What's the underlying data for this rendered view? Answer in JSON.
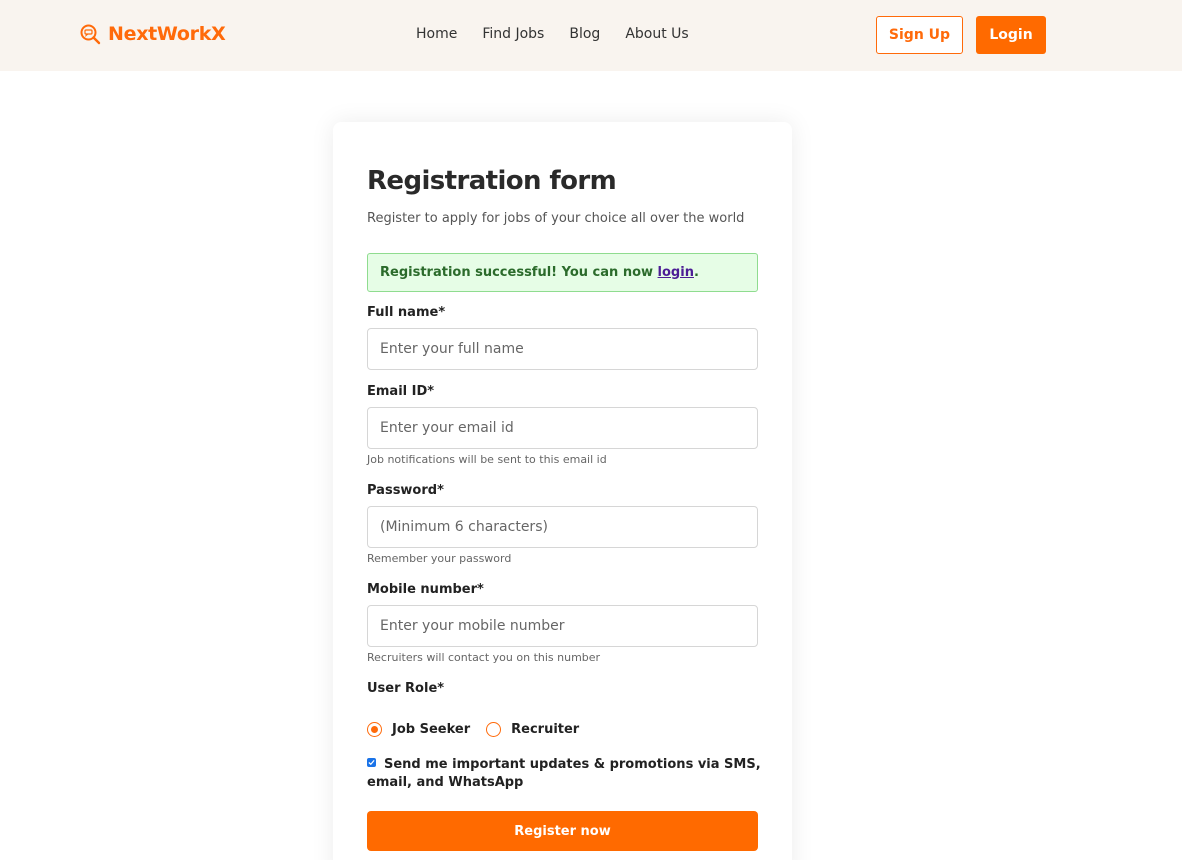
{
  "brand": {
    "name": "NextWorkX",
    "icon": "search-chat-icon",
    "color": "#ff6a0a"
  },
  "nav": {
    "links": [
      "Home",
      "Find Jobs",
      "Blog",
      "About Us"
    ],
    "signup_label": "Sign Up",
    "login_label": "Login"
  },
  "form": {
    "title": "Registration form",
    "subtitle": "Register to apply for jobs of your choice all over the world",
    "alert": {
      "text": "Registration successful! You can now ",
      "link": "login",
      "suffix": "."
    },
    "full_name": {
      "label": "Full name*",
      "placeholder": "Enter your full name"
    },
    "email": {
      "label": "Email ID*",
      "placeholder": "Enter your email id",
      "hint": "Job notifications will be sent to this email id"
    },
    "password": {
      "label": "Password*",
      "placeholder": "(Minimum 6 characters)",
      "hint": "Remember your password"
    },
    "mobile": {
      "label": "Mobile number*",
      "placeholder": "Enter your mobile number",
      "hint": "Recruiters will contact you on this number"
    },
    "role": {
      "label": "User Role*",
      "options": [
        "Job Seeker",
        "Recruiter"
      ],
      "selected": "Job Seeker"
    },
    "updates_checkbox": {
      "label": "Send me important updates & promotions via SMS, email, and WhatsApp",
      "checked": true
    },
    "submit_label": "Register now"
  },
  "colors": {
    "accent": "#ff6a00",
    "navbar_bg": "#f9f4ef",
    "success_bg": "#e6fde6",
    "success_text": "#2b6b2b"
  }
}
